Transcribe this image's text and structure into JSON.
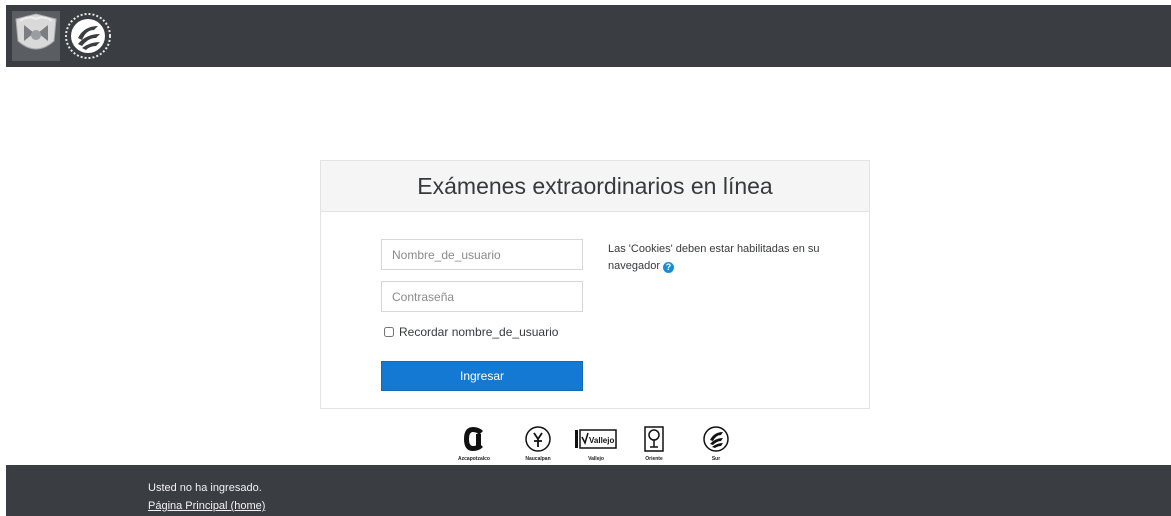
{
  "header": {
    "logo_unam_icon": "unam-shield-icon",
    "logo_cch_icon": "cch-emblem-icon"
  },
  "login": {
    "title": "Exámenes extraordinarios en línea",
    "username_placeholder": "Nombre_de_usuario",
    "password_placeholder": "Contraseña",
    "remember_label": "Recordar nombre_de_usuario",
    "remember_checked": false,
    "submit_label": "Ingresar",
    "cookies_note": "Las 'Cookies' deben estar habilitadas en su navegador",
    "help_icon": "question-circle-icon",
    "accent_color": "#1479d2"
  },
  "campuses": [
    {
      "name": "Azcapotzalco",
      "icon": "azcapotzalco-logo-icon"
    },
    {
      "name": "Naucalpan",
      "icon": "naucalpan-logo-icon"
    },
    {
      "name": "Vallejo",
      "icon": "vallejo-logo-icon",
      "mark_text": "Vallejo"
    },
    {
      "name": "Oriente",
      "icon": "oriente-logo-icon"
    },
    {
      "name": "Sur",
      "icon": "sur-logo-icon"
    }
  ],
  "footer": {
    "status": "Usted no ha ingresado.",
    "home_link": "Página Principal (home)"
  }
}
